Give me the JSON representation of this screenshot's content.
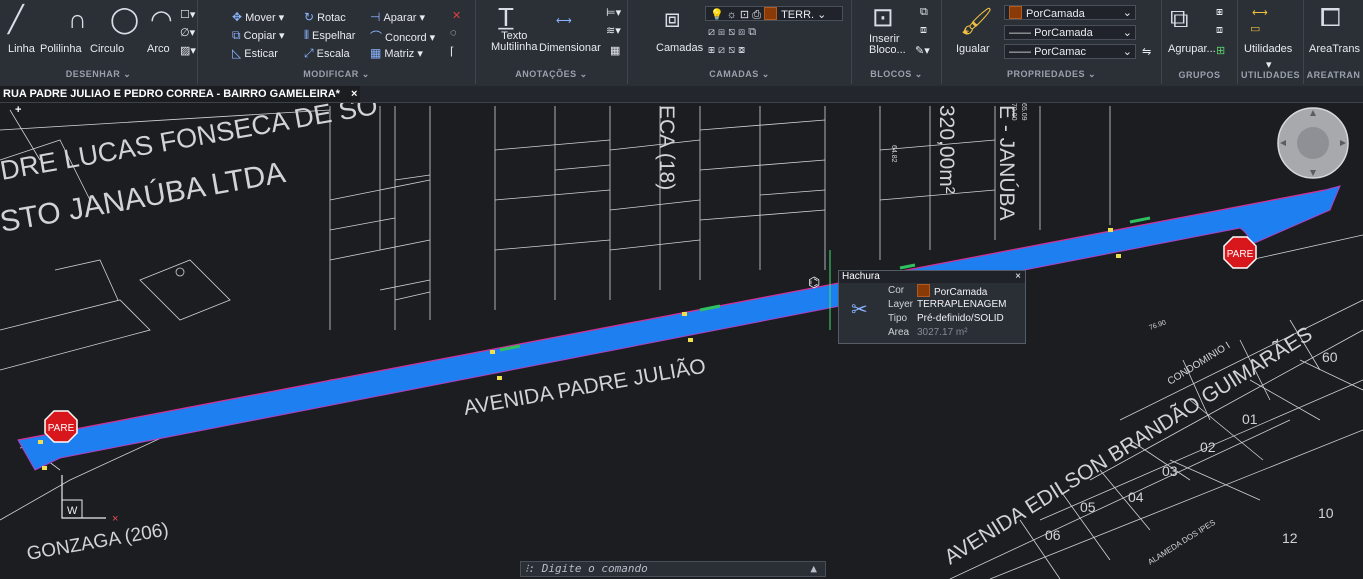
{
  "ribbon": {
    "desenhar": {
      "title": "DESENHAR",
      "linha": "Linha",
      "polilinha": "Polilinha",
      "circulo": "Circulo",
      "arco": "Arco"
    },
    "modificar": {
      "title": "MODIFICAR",
      "mover": "Mover",
      "rotac": "Rotac",
      "aparar": "Aparar",
      "copiar": "Copiar",
      "espelhar": "Espelhar",
      "concord": "Concord",
      "esticar": "Esticar",
      "escala": "Escala",
      "matriz": "Matriz"
    },
    "anotacoes": {
      "title": "ANOTAÇÕES",
      "texto_line1": "Texto",
      "texto_line2": "Multilinha",
      "dimensionar": "Dimensionar"
    },
    "camadas": {
      "title": "CAMADAS",
      "camadas": "Camadas",
      "layer_combo": "TERR."
    },
    "blocos": {
      "title": "BLOCOS",
      "inserir_line1": "Inserir",
      "inserir_line2": "Bloco..."
    },
    "propriedades": {
      "title": "PROPRIEDADES",
      "igualar": "Igualar",
      "cor": "PorCamada",
      "tipo_linha": "PorCamada",
      "espessura": "PorCamac"
    },
    "grupos": {
      "title": "GRUPOS",
      "agrupar": "Agrupar..."
    },
    "utilidades": {
      "title": "UTILIDADES",
      "label": "Utilidades"
    },
    "areatrans": {
      "title": "AREATRAN",
      "label": "AreaTrans"
    }
  },
  "document_tab": {
    "title": "RUA PADRE JULIAO E PEDRO CORREA -  BAIRRO GAMELEIRA*",
    "close": "×",
    "add": "+"
  },
  "drawing": {
    "labels": {
      "padre_lucas": "DRE LUCAS FONSECA DE SO",
      "posto": "STO JANAÚBA LTDA",
      "eca": "ECA (18)",
      "area_320": "320,00m²",
      "januba": "E - JANÚBA",
      "avenida_padre": "AVENIDA   PADRE   JULIÃO",
      "edilson": "AVENIDA   EDILSON   BRANDÃO   GUIMARÃES",
      "gonzaga": "GONZAGA (206)",
      "condominio": "CONDOMINIO I",
      "alameda": "ALAMEDA DOS IPES"
    },
    "lot_numbers": [
      "60",
      "01",
      "02",
      "03",
      "04",
      "05",
      "06",
      "10",
      "12"
    ],
    "small_labels": [
      "65.09",
      "70.00",
      "64.82",
      "76.90"
    ],
    "stop_sign": "PARE",
    "ucs_label": "W"
  },
  "properties_popup": {
    "title": "Hachura",
    "close": "×",
    "rows": [
      {
        "key": "Cor",
        "value": "PorCamada"
      },
      {
        "key": "Layer",
        "value": "TERRAPLENAGEM"
      },
      {
        "key": "Tipo",
        "value": "Pré-definido/SOLID"
      },
      {
        "key": "Area",
        "value": "3027.17 m²"
      }
    ]
  },
  "command_line": {
    "placeholder": "Digite o comando",
    "prefix": "⁝:"
  },
  "colors": {
    "hatch": "#1e7ff0",
    "background": "#1b1d21",
    "ribbon": "#2b2f36",
    "stop": "#d8171d"
  }
}
